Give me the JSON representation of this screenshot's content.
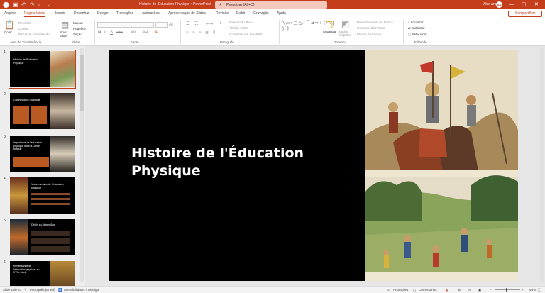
{
  "titlebar": {
    "doc_title": "Histoire-de-lEducation-Physique  •  PowerPoint",
    "search_placeholder": "Pesquisar (Alt+Q)",
    "user_name": "Alex Araujo",
    "user_initials": "AA",
    "quick_icons": [
      "save-icon",
      "undo-icon",
      "redo-icon",
      "present-icon",
      "customize-icon"
    ]
  },
  "tabs": [
    "Arquivo",
    "Página Inicial",
    "Inserir",
    "Desenhar",
    "Design",
    "Transições",
    "Animações",
    "Apresentação de Slides",
    "Revisão",
    "Exibir",
    "Gravação",
    "Ajuda"
  ],
  "active_tab": "Página Inicial",
  "share_label": "Compartilhar",
  "ribbon": {
    "clipboard": {
      "paste": "Colar",
      "cut": "Recortar",
      "copy": "Copiar",
      "format_painter": "Pincel de Formatação",
      "label": "Área de Transferência"
    },
    "slides": {
      "new_slide": "Novo Slide",
      "layout": "Layout",
      "reset": "Redefinir",
      "section": "Seção",
      "reuse": "Reutilizar Slides",
      "label": "Slides"
    },
    "font": {
      "label": "Fonte"
    },
    "paragraph": {
      "text_direction": "Direção do Texto",
      "align_text": "Alinhar Texto",
      "smartart": "Converter em SmartArt",
      "label": "Parágrafo"
    },
    "drawing": {
      "arrange": "Organizar",
      "quick_styles": "Estilos Rápidos",
      "shape_fill": "Preenchimento da Forma",
      "shape_outline": "Contorno da Forma",
      "shape_effects": "Efeitos de Forma",
      "label": "Desenho"
    },
    "editing": {
      "find": "Localizar",
      "replace": "Substituir",
      "select": "Selecionar",
      "label": "Editando"
    }
  },
  "thumbnails": [
    {
      "num": "1",
      "title": "Histoire de l'Éducation Physique"
    },
    {
      "num": "2",
      "title": "Origines dans l'Antiquité"
    },
    {
      "num": "3",
      "title": "Importance de l'éducation physique dans la Grèce antique"
    },
    {
      "num": "4",
      "title": "Vision romaine de l'éducation physique"
    },
    {
      "num": "5",
      "title": "Déclin au Moyen Âge"
    },
    {
      "num": "6",
      "title": "Renaissance de l'éducation physique au XVIIe siècle"
    }
  ],
  "slide": {
    "title": "Histoire de l'Éducation Physique"
  },
  "status": {
    "slide_count": "Slide 1 de 21",
    "language": "Português (Brasil)",
    "accessibility": "Acessibilidade: investigar",
    "notes": "Anotações",
    "comments": "Comentários",
    "zoom": "94%"
  },
  "colors": {
    "accent": "#c43e1c",
    "slide_bg": "#000000"
  }
}
